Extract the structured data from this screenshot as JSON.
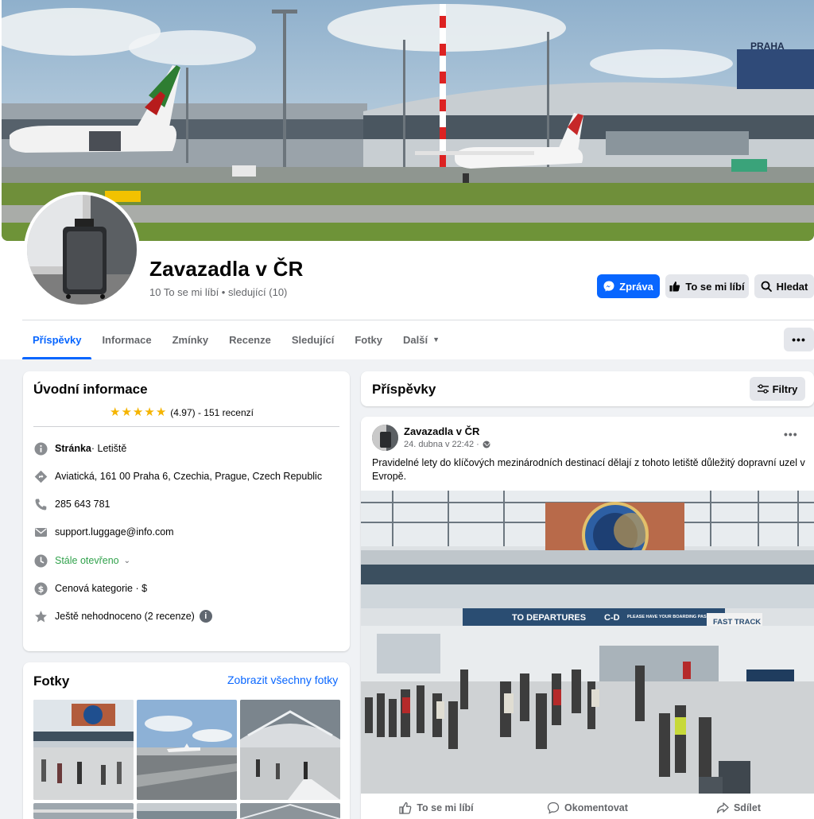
{
  "page": {
    "name": "Zavazadla v ČR",
    "meta": "10 To se mi líbí • sledující (10)"
  },
  "header_buttons": {
    "message": "Zpráva",
    "like": "To se mi líbí",
    "search": "Hledat"
  },
  "tabs": [
    "Příspěvky",
    "Informace",
    "Zmínky",
    "Recenze",
    "Sledující",
    "Fotky",
    "Další"
  ],
  "intro": {
    "title": "Úvodní informace",
    "rating_text": "(4.97) - 151 recenzí",
    "stars": 5,
    "rows": {
      "category_bold": "Stránka",
      "category_rest": " · Letiště",
      "address": "Aviatická, 161 00 Praha 6, Czechia, Prague, Czech Republic",
      "phone": "285 643 781",
      "email": "support.luggage@info.com",
      "hours": "Stále otevřeno",
      "price": "Cenová kategorie · $",
      "unrated": "Ještě nehodnoceno (2 recenze)"
    }
  },
  "photos": {
    "title": "Fotky",
    "show_all": "Zobrazit všechny fotky"
  },
  "posts": {
    "title": "Příspěvky",
    "filter": "Filtry",
    "post": {
      "author": "Zavazadla v ČR",
      "time": "24. dubna v 22:42 ·",
      "text": "Pravidelné lety do klíčových mezinárodních destinací dělají z tohoto letiště důležitý dopravní uzel v Evropě."
    },
    "actions": {
      "like": "To se mi líbí",
      "comment": "Okomentovat",
      "share": "Sdílet"
    }
  },
  "image_text": {
    "cover_sign": "PRAHA",
    "departures": "TO DEPARTURES",
    "gates": "C-D",
    "boarding": "PLEASE HAVE YOUR BOARDING PASS READY",
    "fast_track": "FAST TRACK"
  },
  "colors": {
    "accent": "#0866ff",
    "open_green": "#31a24c",
    "star": "#f5b400"
  }
}
